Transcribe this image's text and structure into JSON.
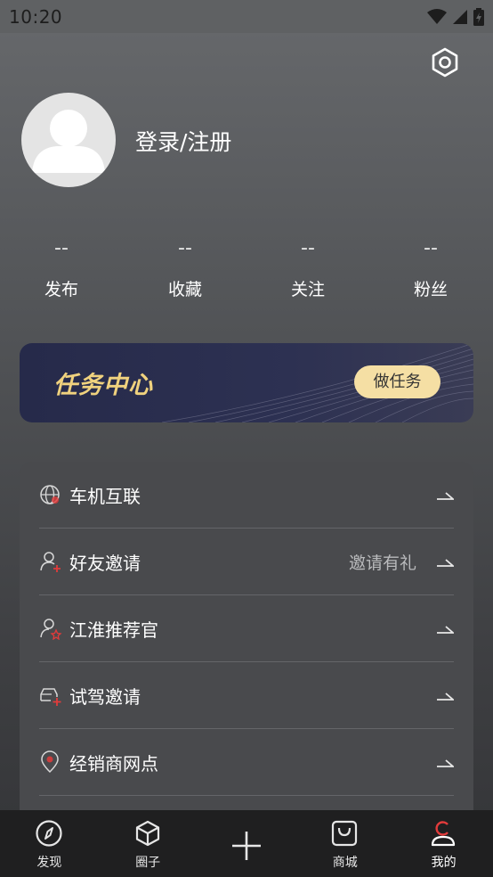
{
  "status_bar": {
    "time": "10:20"
  },
  "profile": {
    "login_text": "登录/注册"
  },
  "stats": [
    {
      "value": "--",
      "label": "发布"
    },
    {
      "value": "--",
      "label": "收藏"
    },
    {
      "value": "--",
      "label": "关注"
    },
    {
      "value": "--",
      "label": "粉丝"
    }
  ],
  "task_banner": {
    "title": "任务中心",
    "button_label": "做任务"
  },
  "menu": [
    {
      "label": "车机互联",
      "extra": "",
      "icon": "globe-icon"
    },
    {
      "label": "好友邀请",
      "extra": "邀请有礼",
      "icon": "user-plus-icon"
    },
    {
      "label": "江淮推荐官",
      "extra": "",
      "icon": "user-star-icon"
    },
    {
      "label": "试驾邀请",
      "extra": "",
      "icon": "car-plus-icon"
    },
    {
      "label": "经销商网点",
      "extra": "",
      "icon": "location-pin-icon"
    }
  ],
  "tab_bar": [
    {
      "label": "发现",
      "icon": "compass-icon"
    },
    {
      "label": "圈子",
      "icon": "cube-icon"
    },
    {
      "label": "",
      "icon": "plus-icon"
    },
    {
      "label": "商城",
      "icon": "shopping-bag-icon"
    },
    {
      "label": "我的",
      "icon": "person-icon",
      "active": true
    }
  ],
  "colors": {
    "accent": "#e23b3b",
    "task_title": "#f0d27e",
    "task_button": "#f5dfa4"
  }
}
